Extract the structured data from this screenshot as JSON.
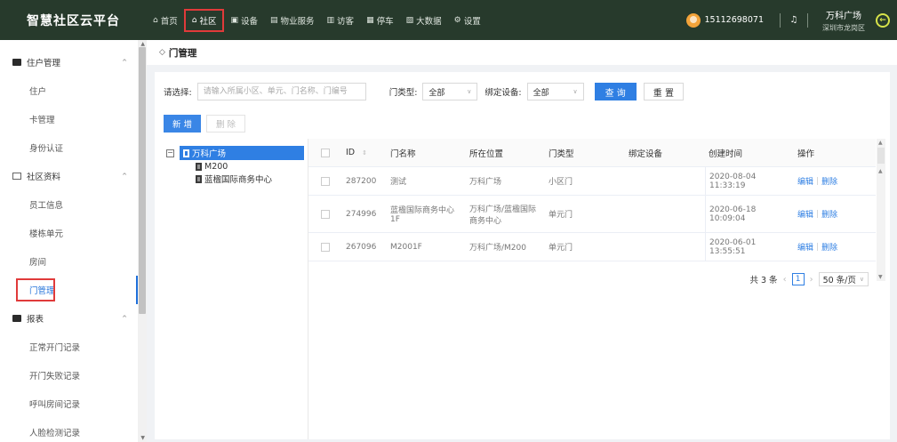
{
  "header": {
    "brand": "智慧社区云平台",
    "nav": [
      {
        "icon": "home-icon",
        "glyph": "⌂",
        "label": "首页",
        "active": false
      },
      {
        "icon": "community-icon",
        "glyph": "⌂",
        "label": "社区",
        "active": true
      },
      {
        "icon": "device-icon",
        "glyph": "▣",
        "label": "设备",
        "active": false
      },
      {
        "icon": "property-service-icon",
        "glyph": "▤",
        "label": "物业服务",
        "active": false
      },
      {
        "icon": "visitor-icon",
        "glyph": "▥",
        "label": "访客",
        "active": false
      },
      {
        "icon": "parking-icon",
        "glyph": "▦",
        "label": "停车",
        "active": false
      },
      {
        "icon": "bigdata-icon",
        "glyph": "▧",
        "label": "大数据",
        "active": false
      },
      {
        "icon": "settings-icon",
        "glyph": "⚙",
        "label": "设置",
        "active": false
      }
    ],
    "phone": "15112698071",
    "org_name": "万科广场",
    "org_area": "深圳市龙岗区",
    "exit_glyph": "←",
    "bell_glyph": "♫"
  },
  "sidebar": {
    "groups": [
      {
        "label": "住户管理",
        "items": [
          "住户",
          "卡管理",
          "身份认证"
        ]
      },
      {
        "label": "社区资料",
        "items": [
          "员工信息",
          "楼栋单元",
          "房间",
          "门管理"
        ]
      },
      {
        "label": "报表",
        "items": [
          "正常开门记录",
          "开门失败记录",
          "呼叫房间记录",
          "人脸检测记录"
        ]
      }
    ],
    "active_item": "门管理"
  },
  "breadcrumb": {
    "title": "门管理",
    "glyph": "◇"
  },
  "filter": {
    "label": "请选择:",
    "search_placeholder": "请输入所属小区、单元、门名称、门编号",
    "door_type_label": "门类型:",
    "door_type_value": "全部",
    "bind_device_label": "绑定设备:",
    "bind_device_value": "全部",
    "query": "查 询",
    "reset": "重 置"
  },
  "actions": {
    "add": "新 增",
    "delete": "删 除"
  },
  "tree": {
    "root": "万科广场",
    "toggle": "−",
    "children": [
      "M200",
      "蓝楹国际商务中心"
    ]
  },
  "table": {
    "headers": {
      "id": "ID",
      "name": "门名称",
      "location": "所在位置",
      "type": "门类型",
      "device": "绑定设备",
      "created": "创建时间",
      "ops": "操作"
    },
    "rows": [
      {
        "id": "287200",
        "name": "测试",
        "location": "万科广场",
        "type": "小区门",
        "device": "",
        "created": "2020-08-04 11:33:19",
        "edit": "编辑",
        "delete": "删除"
      },
      {
        "id": "274996",
        "name": "蓝楹国际商务中心1F",
        "location": "万科广场/蓝楹国际商务中心",
        "type": "单元门",
        "device": "",
        "created": "2020-06-18 10:09:04",
        "edit": "编辑",
        "delete": "删除"
      },
      {
        "id": "267096",
        "name": "M2001F",
        "location": "万科广场/M200",
        "type": "单元门",
        "device": "",
        "created": "2020-06-01 13:55:51",
        "edit": "编辑",
        "delete": "删除"
      }
    ]
  },
  "pagination": {
    "total": "共 3 条",
    "current": "1",
    "page_size": "50 条/页"
  }
}
